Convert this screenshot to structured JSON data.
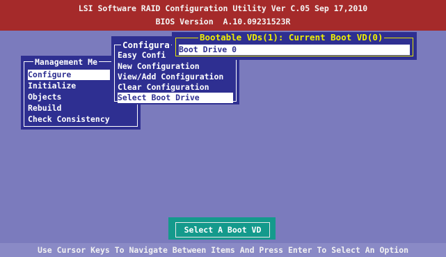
{
  "header": {
    "line1": "LSI Software RAID Configuration Utility Ver C.05 Sep 17,2010",
    "line2": "BIOS Version  A.10.09231523R"
  },
  "management_menu": {
    "title": "Management Me",
    "items": [
      "Configure",
      "Initialize",
      "Objects",
      "Rebuild",
      "Check Consistency"
    ],
    "selected": "Configure"
  },
  "configure_menu": {
    "title": "Configura",
    "items": [
      "Easy Confi",
      "New Configuration",
      "View/Add Configuration",
      "Clear Configuration",
      "Select Boot Drive"
    ],
    "selected": "Select Boot Drive"
  },
  "boot_popup": {
    "title": "Bootable VDs(1): Current Boot VD(0)",
    "items": [
      "Boot Drive 0"
    ]
  },
  "status_box": {
    "label": "Select A Boot VD"
  },
  "footer": {
    "hint": "Use Cursor Keys To Navigate Between Items And Press Enter To Select An Option"
  },
  "colors": {
    "background": "#7b7bbd",
    "header": "#a52a2a",
    "panel": "#2e2f91",
    "popup_border": "#e6e600",
    "status_box": "#149a8c"
  }
}
